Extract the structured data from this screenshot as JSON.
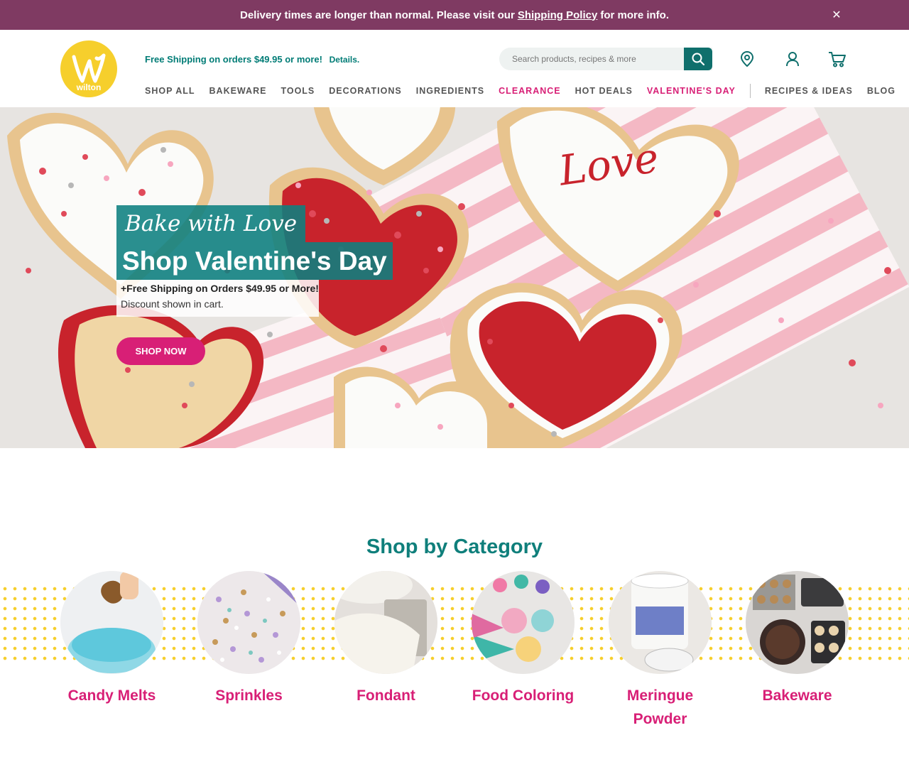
{
  "announcement": {
    "text_before": "Delivery times are longer than normal. Please visit our",
    "link": "Shipping Policy",
    "text_after": "for more info.",
    "close_icon": "close-icon"
  },
  "header": {
    "logo_text": "wilton",
    "promo_text": "Free Shipping on orders $49.95 or more!",
    "promo_link": "Details.",
    "search_placeholder": "Search products, recipes & more",
    "icons": [
      "search-icon",
      "location-pin-icon",
      "user-account-icon",
      "cart-icon"
    ],
    "nav": [
      {
        "label": "SHOP ALL",
        "accent": false
      },
      {
        "label": "BAKEWARE",
        "accent": false
      },
      {
        "label": "TOOLS",
        "accent": false
      },
      {
        "label": "DECORATIONS",
        "accent": false
      },
      {
        "label": "INGREDIENTS",
        "accent": false
      },
      {
        "label": "CLEARANCE",
        "accent": true
      },
      {
        "label": "HOT DEALS",
        "accent": false
      },
      {
        "label": "VALENTINE'S DAY",
        "accent": true
      },
      {
        "label": "RECIPES & IDEAS",
        "accent": false
      },
      {
        "label": "BLOG",
        "accent": false
      }
    ]
  },
  "hero": {
    "script_title": "Bake with Love",
    "title": "Shop Valentine's Day",
    "subtitle": "+Free Shipping on Orders $49.95 or More!",
    "note": "Discount shown in cart.",
    "cta": "SHOP NOW"
  },
  "categories": {
    "title": "Shop by Category",
    "items": [
      {
        "label": "Candy Melts"
      },
      {
        "label": "Sprinkles"
      },
      {
        "label": "Fondant"
      },
      {
        "label": "Food Coloring"
      },
      {
        "label": "Meringue Powder"
      },
      {
        "label": "Bakeware"
      }
    ]
  },
  "colors": {
    "announcement_bg": "#7f3a62",
    "teal": "#0f7f7b",
    "pink": "#d81f76",
    "logo_yellow": "#f6cf2c",
    "cookie_red": "#c8232c"
  }
}
